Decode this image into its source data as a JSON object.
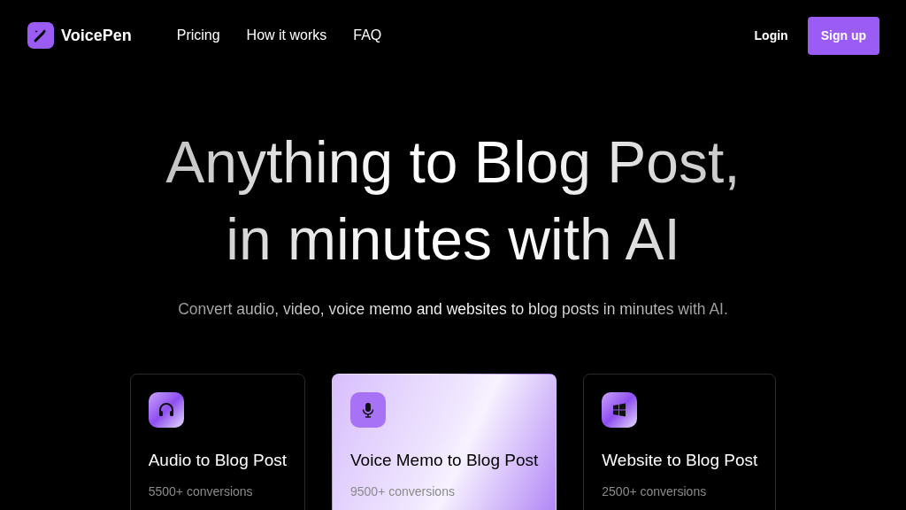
{
  "brand": {
    "name": "VoicePen"
  },
  "nav": [
    {
      "label": "Pricing"
    },
    {
      "label": "How it works"
    },
    {
      "label": "FAQ"
    }
  ],
  "auth": {
    "login": "Login",
    "signup": "Sign up"
  },
  "hero": {
    "title_lines": [
      "Anything to Blog Post,",
      "in minutes with AI"
    ],
    "subtitle": "Convert audio, video, voice memo and websites to blog posts in minutes with AI."
  },
  "cards": [
    {
      "kind": "audio",
      "title": "Audio to Blog Post",
      "count": "5500+ conversions",
      "selected": false
    },
    {
      "kind": "voice",
      "title": "Voice Memo to Blog Post",
      "count": "9500+ conversions",
      "selected": true
    },
    {
      "kind": "website",
      "title": "Website to Blog Post",
      "count": "2500+ conversions",
      "selected": false
    }
  ]
}
